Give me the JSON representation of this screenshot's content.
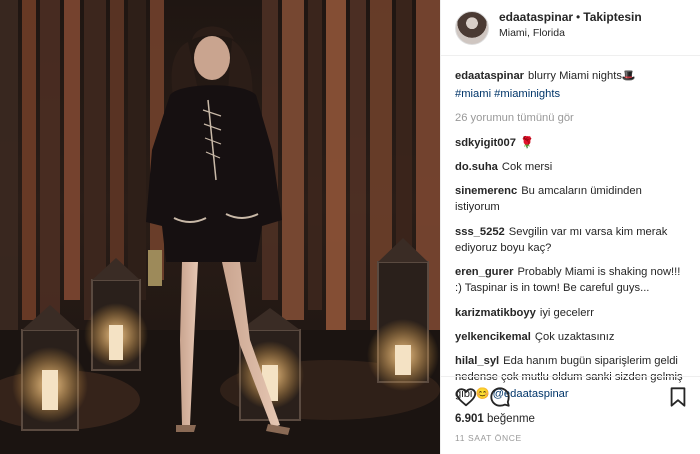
{
  "post": {
    "username": "edaataspinar",
    "separator": "•",
    "follow_label": "Takiptesin",
    "location": "Miami, Florida",
    "caption_user": "edaataspinar",
    "caption_text": "blurry Miami nights",
    "caption_emoji": "🎩",
    "hashtags": "#miami #miaminights",
    "view_all": "26 yorumun tümünü gör",
    "likes_count": "6.901",
    "likes_word": "beğenme",
    "time_ago": "11 SAAT ÖNCE"
  },
  "comments": [
    {
      "user": "sdkyigit007",
      "text": "🌹"
    },
    {
      "user": "do.suha",
      "text": "Cok mersi"
    },
    {
      "user": "sinemerenc",
      "text": "Bu amcaların ümidinden istiyorum"
    },
    {
      "user": "sss_5252",
      "text": "Sevgilin var mı varsa kim merak ediyoruz boyu kaç?"
    },
    {
      "user": "eren_gurer",
      "text": "Probably Miami is shaking now!!! :) Taspinar is in town! Be careful guys..."
    },
    {
      "user": "karizmatikboyy",
      "text": "iyi gecelerr"
    },
    {
      "user": "yelkencikemal",
      "text": "Çok uzaktasınız"
    },
    {
      "user": "hilal_syl",
      "text": "Eda hanım bugün siparişlerim geldi nedense çok mutlu oldum sanki sizden gelmiş gibi 😊",
      "mention": "@edaataspinar"
    }
  ],
  "icons": {
    "like": "heart-icon",
    "comment": "comment-icon",
    "save": "bookmark-icon"
  },
  "colors": {
    "text": "#262626",
    "link": "#003569",
    "muted": "#999999",
    "border": "#efefef"
  }
}
